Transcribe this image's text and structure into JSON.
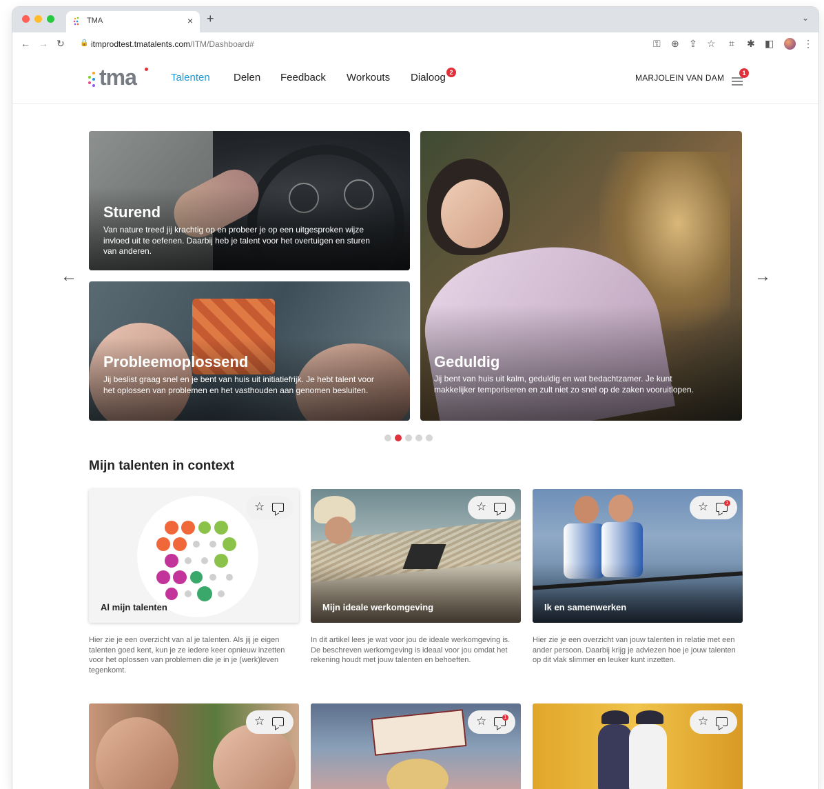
{
  "browser": {
    "tab_title": "TMA",
    "url_host": "itmprodtest.tmatalents.com",
    "url_path": "/ITM/Dashboard#"
  },
  "header": {
    "logo_text": "tma",
    "nav": [
      "Talenten",
      "Delen",
      "Feedback",
      "Workouts",
      "Dialoog"
    ],
    "active_nav": "Talenten",
    "dialoog_badge": "2",
    "user_name": "MARJOLEIN VAN DAM",
    "menu_badge": "1",
    "accent_color": "#1f9ad6",
    "badge_color": "#e0313b"
  },
  "carousel": {
    "cards": [
      {
        "title": "Sturend",
        "text": "Van nature treed jij krachtig op en probeer je op een uitgesproken wijze invloed uit te oefenen. Daarbij heb je talent voor het overtuigen en sturen van anderen."
      },
      {
        "title": "Probleemoplossend",
        "text": "Jij beslist graag snel en je bent van huis uit initiatiefrijk. Je hebt talent voor het oplossen van problemen en het vasthouden aan genomen besluiten."
      },
      {
        "title": "Geduldig",
        "text": "Jij bent van huis uit kalm, geduldig en wat bedachtzamer. Je kunt makkelijker temporiseren en zult niet zo snel op de zaken vooruitlopen."
      }
    ],
    "prev_icon": "arrow-left-icon",
    "next_icon": "arrow-right-icon",
    "page_count": 5,
    "active_page": 2
  },
  "context": {
    "title": "Mijn talenten in context",
    "cards": [
      {
        "title": "Al mijn talenten",
        "text": "Hier zie je een overzicht van al je talenten. Als jij je eigen talenten goed kent, kun je ze iedere keer opnieuw inzetten voor het oplossen van problemen die je in je (werk)leven tegenkomt.",
        "comment_badge": ""
      },
      {
        "title": "Mijn ideale werkomgeving",
        "text": "In dit artikel lees je wat voor jou de ideale werkomgeving is. De beschreven werkomgeving is ideaal voor jou omdat het rekening houdt met jouw talenten en behoeften.",
        "comment_badge": ""
      },
      {
        "title": "Ik en samenwerken",
        "text": "Hier zie je een overzicht van jouw talenten in relatie met een ander persoon. Daarbij krijg je adviezen hoe je jouw talenten op dit vlak slimmer en leuker kunt inzetten.",
        "comment_badge": "1"
      }
    ],
    "row2_comment_badges": [
      "",
      "1",
      ""
    ]
  }
}
